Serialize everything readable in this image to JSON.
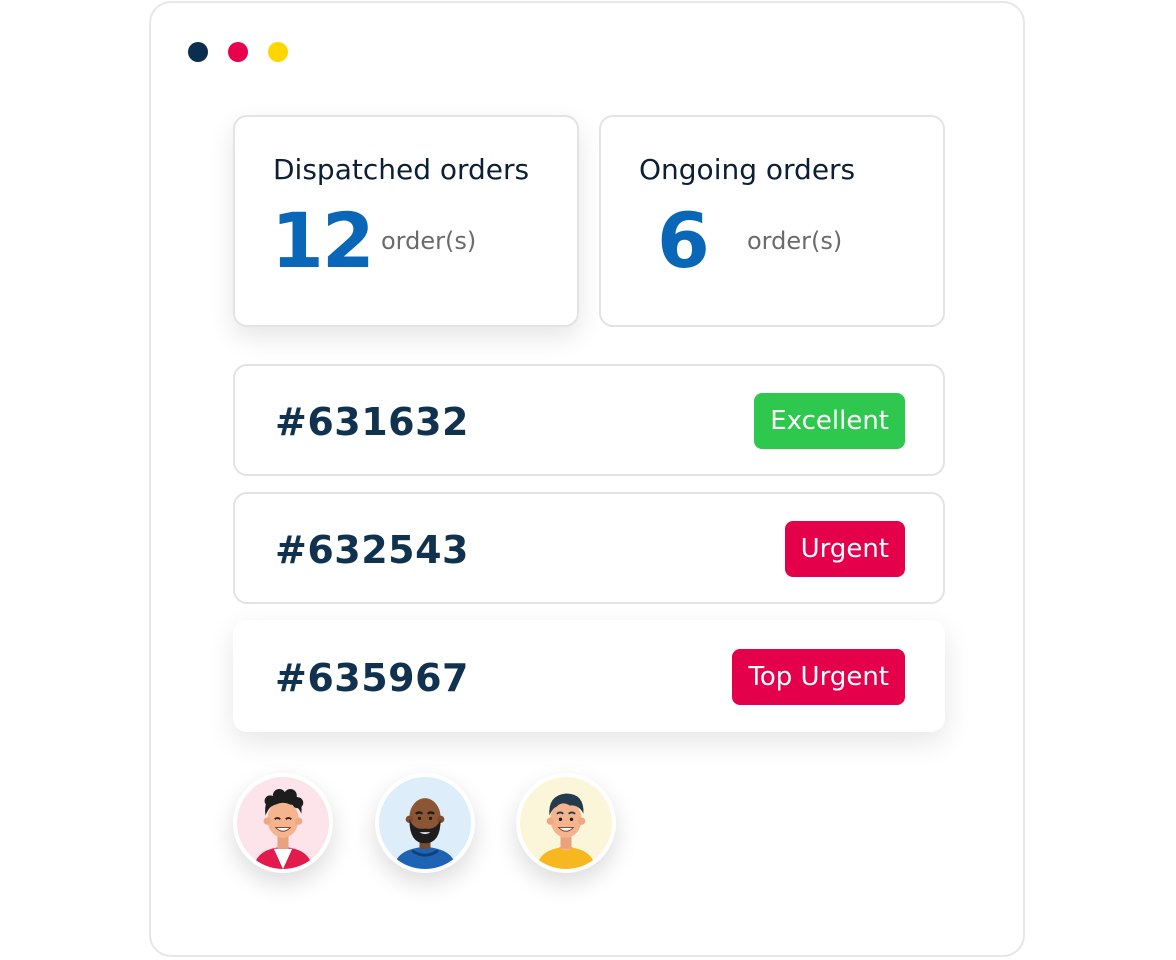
{
  "window": {
    "controls": [
      {
        "icon": "close-dot-icon",
        "color": "#0b2d4e"
      },
      {
        "icon": "minimize-dot-icon",
        "color": "#e8004d"
      },
      {
        "icon": "maximize-dot-icon",
        "color": "#ffd600"
      }
    ]
  },
  "stats": [
    {
      "title": "Dispatched orders",
      "value": "12",
      "unit": "order(s)"
    },
    {
      "title": "Ongoing orders",
      "value": "6",
      "unit": "order(s)"
    }
  ],
  "orders": [
    {
      "id": "#631632",
      "status": "Excellent",
      "status_color": "#2ec84f"
    },
    {
      "id": "#632543",
      "status": "Urgent",
      "status_color": "#e5004b"
    },
    {
      "id": "#635967",
      "status": "Top Urgent",
      "status_color": "#e5004b"
    }
  ],
  "avatars": [
    {
      "icon": "user-avatar-curly-hair-icon",
      "bg": "#fde3ea"
    },
    {
      "icon": "user-avatar-bearded-icon",
      "bg": "#ddeefa"
    },
    {
      "icon": "user-avatar-smiling-icon",
      "bg": "#fbf6d9"
    }
  ],
  "colors": {
    "accent": "#0a66b7",
    "text_dark": "#11324e",
    "border": "#e3e3e3"
  }
}
